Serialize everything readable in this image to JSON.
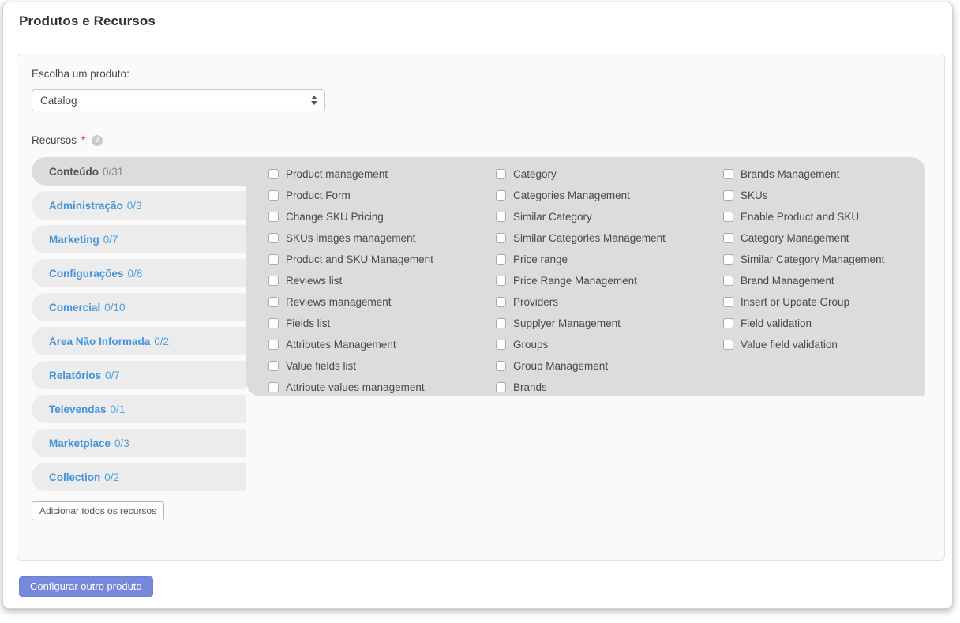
{
  "page": {
    "title": "Produtos e Recursos"
  },
  "product_select": {
    "label": "Escolha um produto:",
    "value": "Catalog"
  },
  "resources": {
    "label": "Recursos",
    "required_marker": "*",
    "help_icon_glyph": "?",
    "tabs": [
      {
        "label": "Conteúdo",
        "count": "0/31",
        "active": true
      },
      {
        "label": "Administração",
        "count": "0/3",
        "active": false
      },
      {
        "label": "Marketing",
        "count": "0/7",
        "active": false
      },
      {
        "label": "Configurações",
        "count": "0/8",
        "active": false
      },
      {
        "label": "Comercial",
        "count": "0/10",
        "active": false
      },
      {
        "label": "Área Não Informada",
        "count": "0/2",
        "active": false
      },
      {
        "label": "Relatórios",
        "count": "0/7",
        "active": false
      },
      {
        "label": "Televendas",
        "count": "0/1",
        "active": false
      },
      {
        "label": "Marketplace",
        "count": "0/3",
        "active": false
      },
      {
        "label": "Collection",
        "count": "0/2",
        "active": false
      }
    ],
    "add_all_button": "Adicionar todos os recursos",
    "checkbox_columns": [
      [
        "Product management",
        "Product Form",
        "Change SKU Pricing",
        "SKUs images management",
        "Product and SKU Management",
        "Reviews list",
        "Reviews management",
        "Fields list",
        "Attributes Management",
        "Value fields list",
        "Attribute values management"
      ],
      [
        "Category",
        "Categories Management",
        "Similar Category",
        "Similar Categories Management",
        "Price range",
        "Price Range Management",
        "Providers",
        "Supplyer Management",
        "Groups",
        "Group Management",
        "Brands"
      ],
      [
        "Brands Management",
        "SKUs",
        "Enable Product and SKU",
        "Category Management",
        "Similar Category Management",
        "Brand Management",
        "Insert or Update Group",
        "Field validation",
        "Value field validation"
      ]
    ],
    "all_checkboxes_checked": false
  },
  "footer": {
    "configure_button": "Configurar outro produto"
  },
  "colors": {
    "accent_blue": "#4394d8",
    "panel_gray": "#dcdcdc",
    "inactive_tab_gray": "#ececec",
    "button_blue": "#7689db",
    "required_red": "#e02b27"
  }
}
